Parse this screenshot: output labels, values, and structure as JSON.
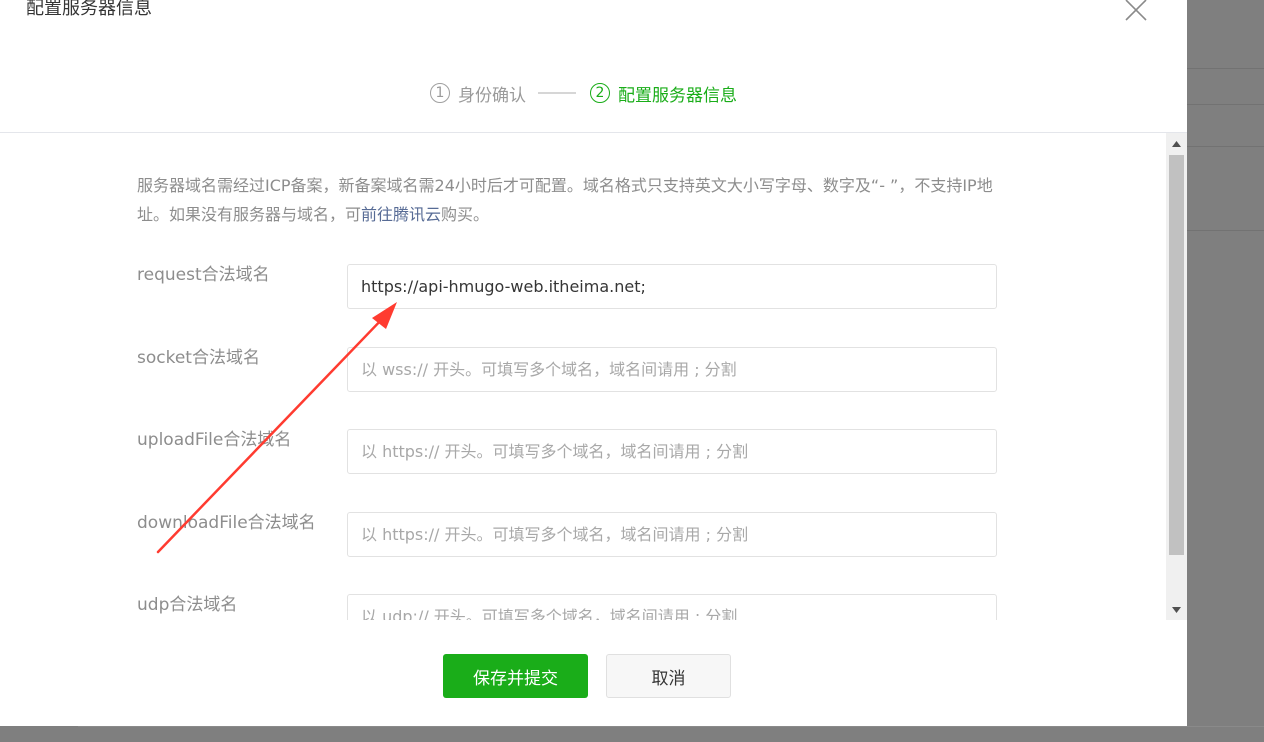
{
  "dialog": {
    "title": "配置服务器信息",
    "close_icon": "close-icon"
  },
  "steps": [
    {
      "num": "1",
      "label": "身份确认",
      "active": false
    },
    {
      "num": "2",
      "label": "配置服务器信息",
      "active": true
    }
  ],
  "notice": {
    "text_before": "服务器域名需经过ICP备案，新备案域名需24小时后才可配置。域名格式只支持英文大小写字母、数字及“- ”，不支持IP地址。如果没有服务器与域名，可",
    "link": "前往腾讯云",
    "text_after": "购买。"
  },
  "fields": [
    {
      "label": "request合法域名",
      "value": "https://api-hmugo-web.itheima.net;",
      "placeholder": ""
    },
    {
      "label": "socket合法域名",
      "value": "",
      "placeholder": "以 wss:// 开头。可填写多个域名，域名间请用 ; 分割"
    },
    {
      "label": "uploadFile合法域名",
      "value": "",
      "placeholder": "以 https:// 开头。可填写多个域名，域名间请用 ; 分割"
    },
    {
      "label": "downloadFile合法域名",
      "value": "",
      "placeholder": "以 https:// 开头。可填写多个域名，域名间请用 ; 分割"
    },
    {
      "label": "udp合法域名",
      "value": "",
      "placeholder": "以 udp:// 开头。可填写多个域名，域名间请用 ; 分割"
    }
  ],
  "buttons": {
    "submit": "保存并提交",
    "cancel": "取消"
  },
  "colors": {
    "accent": "#1aad19",
    "link": "#576b95",
    "annotation_arrow": "#ff3b30"
  }
}
